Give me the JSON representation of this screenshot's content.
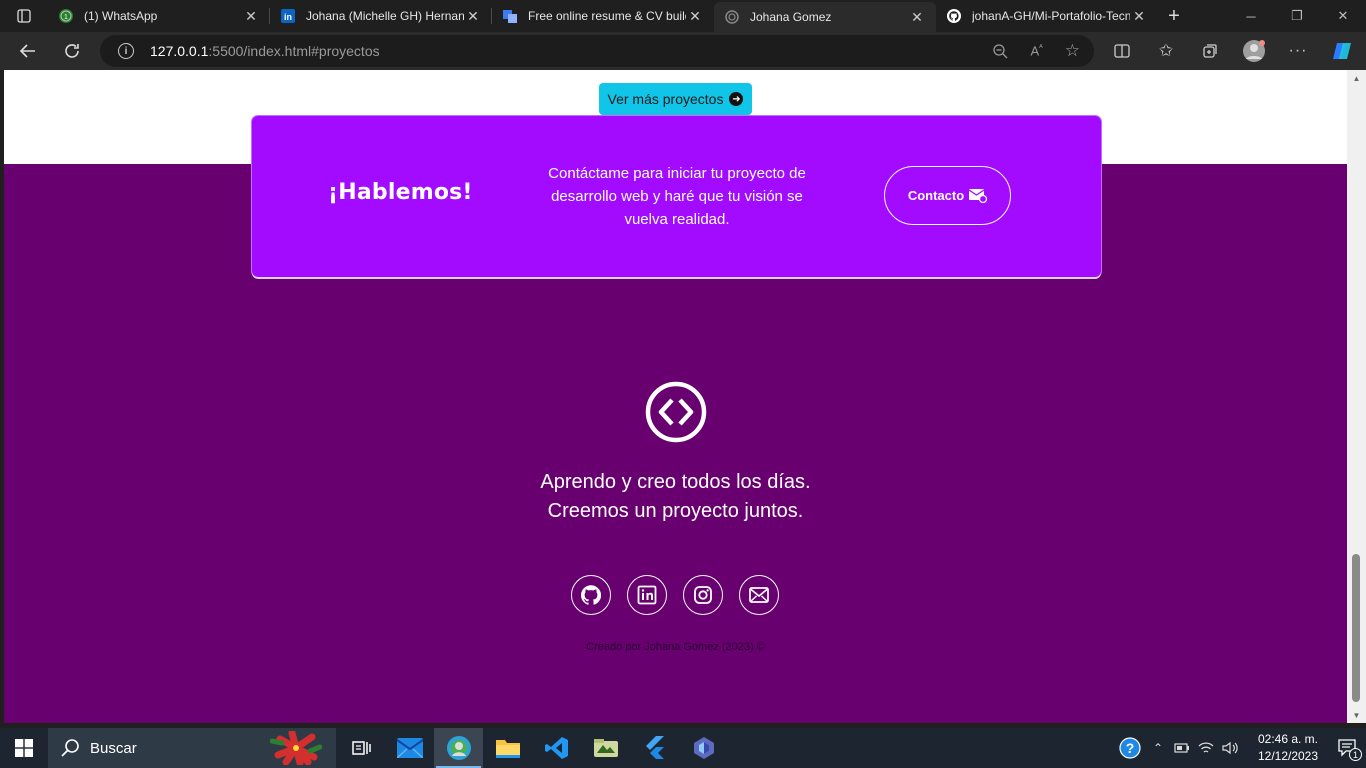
{
  "browser": {
    "tabs": [
      {
        "title": "(1) WhatsApp",
        "icon": "whatsapp-icon",
        "active": false
      },
      {
        "title": "Johana (Michelle GH) Hernandez",
        "icon": "linkedin-icon",
        "active": false
      },
      {
        "title": "Free online resume & CV builder",
        "icon": "resume-builder-icon",
        "active": false
      },
      {
        "title": "Johana Gomez",
        "icon": "loading-icon",
        "active": true
      },
      {
        "title": "johanA-GH/Mi-Portafolio-Tecnico",
        "icon": "github-icon",
        "active": false
      }
    ],
    "url_host": "127.0.0.1",
    "url_rest": ":5500/index.html#proyectos"
  },
  "page": {
    "more_projects_label": "Ver más proyectos",
    "cta": {
      "title": "¡Hablemos!",
      "text": "Contáctame para iniciar tu proyecto de desarrollo web y haré que tu visión se vuelva realidad.",
      "button_label": "Contacto"
    },
    "footer": {
      "line1": "Aprendo y creo todos los días.",
      "line2": "Creemos un proyecto juntos.",
      "social": [
        "github-icon",
        "linkedin-icon",
        "instagram-icon",
        "mail-icon"
      ],
      "credits": "Creado por Johana Gomez (2023) ©"
    },
    "colors": {
      "page_bg": "#680070",
      "cta_bg": "#a20bff",
      "button_bg": "#11c5e8"
    }
  },
  "taskbar": {
    "search_placeholder": "Buscar",
    "time": "02:46 a. m.",
    "date": "12/12/2023",
    "notification_count": "1"
  }
}
